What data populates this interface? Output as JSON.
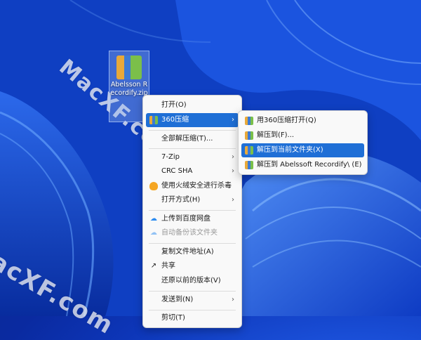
{
  "desktop": {
    "icon_label": "Abelsson Recordify.zip"
  },
  "watermarks": [
    "MacXF.com",
    "acXF.com"
  ],
  "context_menu": {
    "items": [
      {
        "label": "打开(O)",
        "icon": "none",
        "has_submenu": false
      },
      {
        "label": "360压缩",
        "icon": "archive-icon",
        "has_submenu": true,
        "highlighted": true
      },
      {
        "label": "全部解压缩(T)...",
        "icon": "none",
        "has_submenu": false
      },
      {
        "label": "7-Zip",
        "icon": "none",
        "has_submenu": true
      },
      {
        "label": "CRC SHA",
        "icon": "none",
        "has_submenu": true
      },
      {
        "label": "使用火绒安全进行杀毒",
        "icon": "fire-icon",
        "has_submenu": false
      },
      {
        "label": "打开方式(H)",
        "icon": "none",
        "has_submenu": true
      },
      {
        "label": "上传到百度网盘",
        "icon": "cloud-icon",
        "has_submenu": false
      },
      {
        "label": "自动备份该文件夹",
        "icon": "cloud-icon",
        "has_submenu": false,
        "disabled": true
      },
      {
        "label": "复制文件地址(A)",
        "icon": "none",
        "has_submenu": false
      },
      {
        "label": "共享",
        "icon": "share-icon",
        "has_submenu": false
      },
      {
        "label": "还原以前的版本(V)",
        "icon": "none",
        "has_submenu": false
      },
      {
        "label": "发送到(N)",
        "icon": "none",
        "has_submenu": true
      },
      {
        "label": "剪切(T)",
        "icon": "none",
        "has_submenu": false
      }
    ]
  },
  "submenu": {
    "items": [
      {
        "label": "用360压缩打开(Q)",
        "icon": "archive-icon"
      },
      {
        "label": "解压到(F)...",
        "icon": "archive-icon"
      },
      {
        "label": "解压到当前文件夹(X)",
        "icon": "archive-icon",
        "highlighted": true
      },
      {
        "label": "解压到 Abelssoft Recordify\\ (E)",
        "icon": "archive-icon"
      }
    ]
  },
  "colors": {
    "highlight": "#1f6fd6",
    "wallpaper_base": "#0d36b8"
  }
}
